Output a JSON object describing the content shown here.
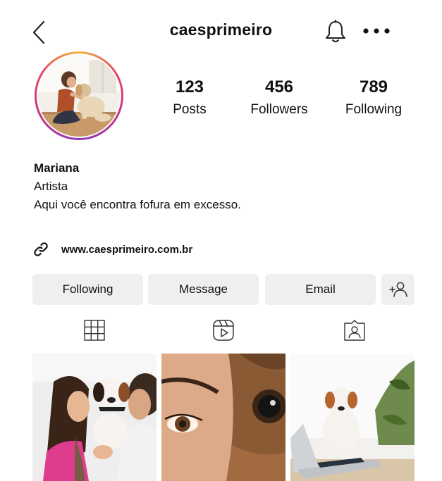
{
  "header": {
    "username": "caesprimeiro",
    "back_icon": "chevron-left-icon",
    "notification_icon": "bell-icon",
    "more_icon": "more-horizontal-icon"
  },
  "profile": {
    "avatar_description_icon": "avatar",
    "stats": [
      {
        "value": "123",
        "label": "Posts"
      },
      {
        "value": "456",
        "label": "Followers"
      },
      {
        "value": "789",
        "label": "Following"
      }
    ],
    "name": "Mariana",
    "category": "Artista",
    "bio": "Aqui você encontra fofura em excesso.",
    "link_icon": "link-icon",
    "website": "www.caesprimeiro.com.br"
  },
  "actions": {
    "following_label": "Following",
    "message_label": "Message",
    "email_label": "Email",
    "add_user_icon": "add-person-icon"
  },
  "tabs": [
    {
      "icon": "grid-icon"
    },
    {
      "icon": "reels-icon"
    },
    {
      "icon": "tagged-icon"
    }
  ],
  "colors": {
    "button_bg": "#efefef",
    "text": "#111111",
    "avatar_ring_start": "#f6b33c",
    "avatar_ring_end": "#8a3ab9"
  }
}
